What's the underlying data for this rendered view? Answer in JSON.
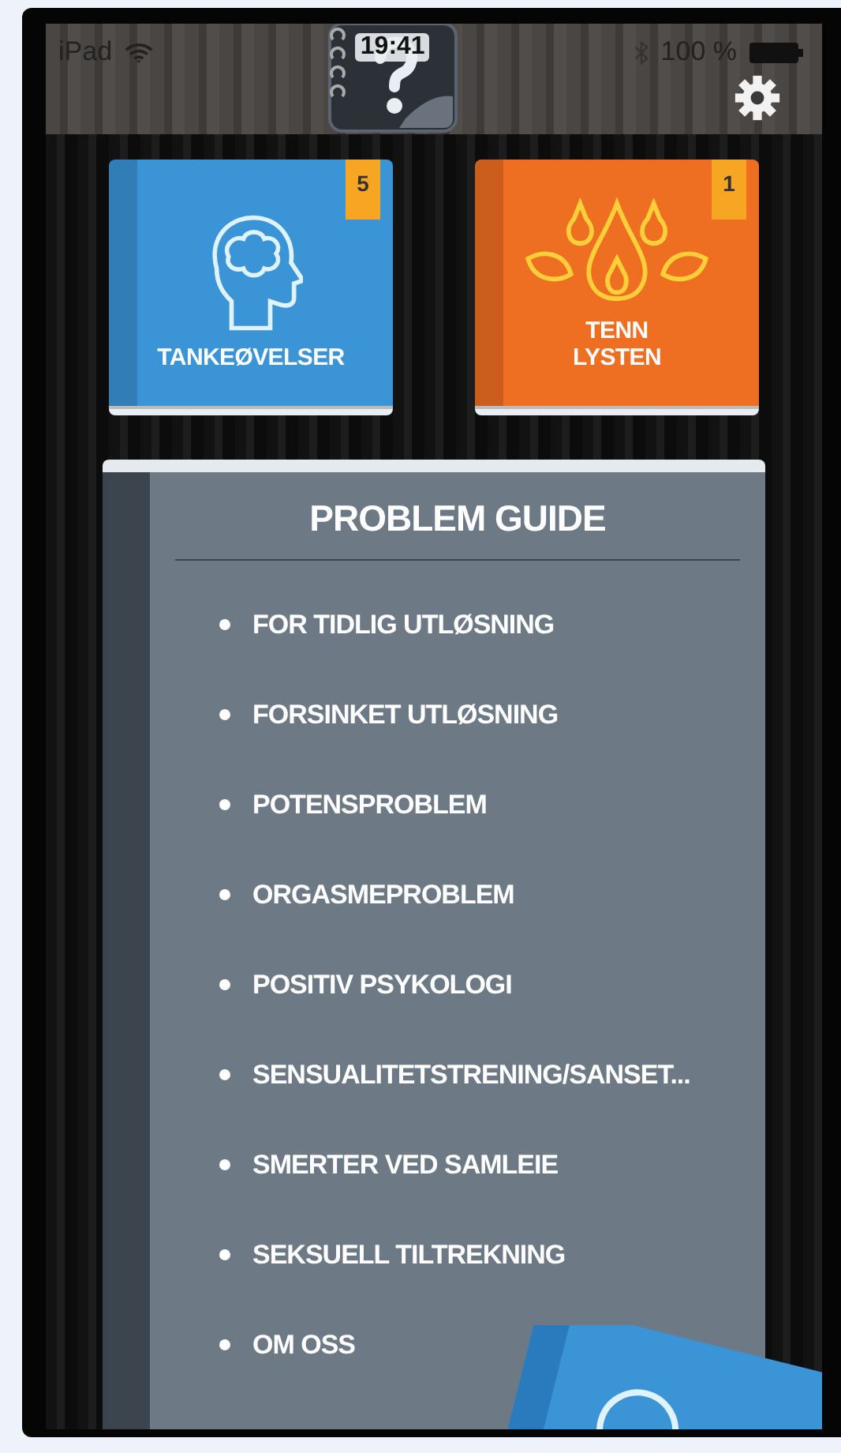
{
  "status_bar": {
    "carrier": "iPad",
    "time": "19:41",
    "battery": "100 %"
  },
  "tiles": [
    {
      "label": "TANKEØVELSER",
      "badge": "5",
      "kind": "brain",
      "color": "#3a94d6"
    },
    {
      "label": "TENN LYSTEN",
      "badge": "1",
      "kind": "flame",
      "color": "#ef6f22"
    }
  ],
  "guide": {
    "title": "PROBLEM GUIDE",
    "items": [
      "FOR TIDLIG UTLØSNING",
      "FORSINKET UTLØSNING",
      "POTENSPROBLEM",
      "ORGASMEPROBLEM",
      "POSITIV PSYKOLOGI",
      "SENSUALITETSTRENING/SANSET...",
      "SMERTER VED SAMLEIE",
      "SEKSUELL TILTREKNING",
      "OM OSS"
    ]
  }
}
